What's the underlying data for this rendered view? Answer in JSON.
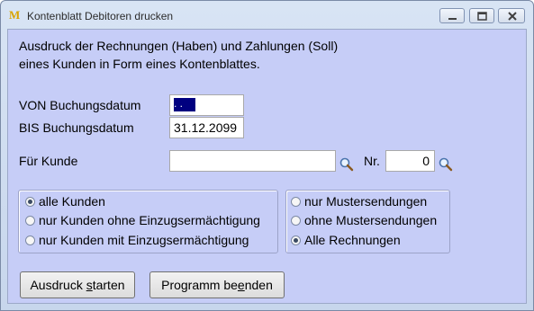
{
  "window": {
    "title": "Kontenblatt Debitoren drucken",
    "app_icon": "M",
    "controls": [
      "minimize-icon",
      "maximize-icon",
      "close-icon"
    ]
  },
  "description": {
    "line1": "Ausdruck der Rechnungen (Haben) und Zahlungen (Soll)",
    "line2": "eines Kunden in Form eines Kontenblattes."
  },
  "form": {
    "von_label": "VON Buchungsdatum",
    "von_value": ". .",
    "bis_label": "BIS Buchungsdatum",
    "bis_value": "31.12.2099",
    "kunde_label": "Für Kunde",
    "kunde_value": "",
    "nr_label": "Nr.",
    "nr_value": "0"
  },
  "customer_group": {
    "options": [
      "alle Kunden",
      "nur Kunden ohne Einzugsermächtigung",
      "nur Kunden mit Einzugsermächtigung"
    ],
    "selected": 0
  },
  "invoice_group": {
    "options": [
      "nur Mustersendungen",
      "ohne Mustersendungen",
      "Alle Rechnungen"
    ],
    "selected": 2
  },
  "buttons": {
    "start_prefix": "Ausdruck ",
    "start_hotkey": "s",
    "start_suffix": "tarten",
    "quit_prefix": "Programm be",
    "quit_hotkey": "e",
    "quit_suffix": "nden"
  },
  "colors": {
    "client_background": "#c6cdf7",
    "selection": "#000080"
  }
}
